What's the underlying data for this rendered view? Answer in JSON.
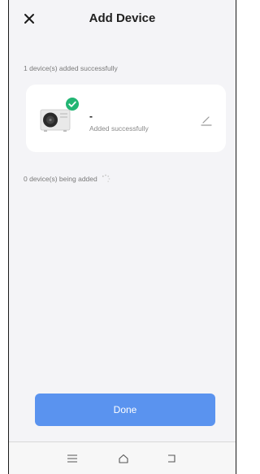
{
  "header": {
    "title": "Add Device",
    "close_icon": "close-icon"
  },
  "added_section": {
    "label": "1 device(s) added successfully",
    "devices": [
      {
        "name": "-",
        "status": "Added successfully",
        "image_icon": "heat-pump-unit-icon",
        "badge_icon": "check-circle-icon",
        "edit_icon": "edit-pencil-icon"
      }
    ]
  },
  "adding_section": {
    "label": "0 device(s) being added",
    "spinner_icon": "loading-spinner-icon"
  },
  "done_button": {
    "label": "Done"
  },
  "navbar": {
    "menu_icon": "menu-icon",
    "home_icon": "home-icon",
    "back_icon": "back-icon"
  },
  "colors": {
    "accent": "#5a93ef",
    "success": "#22b573",
    "background": "#f4f4f7",
    "card": "#ffffff"
  }
}
